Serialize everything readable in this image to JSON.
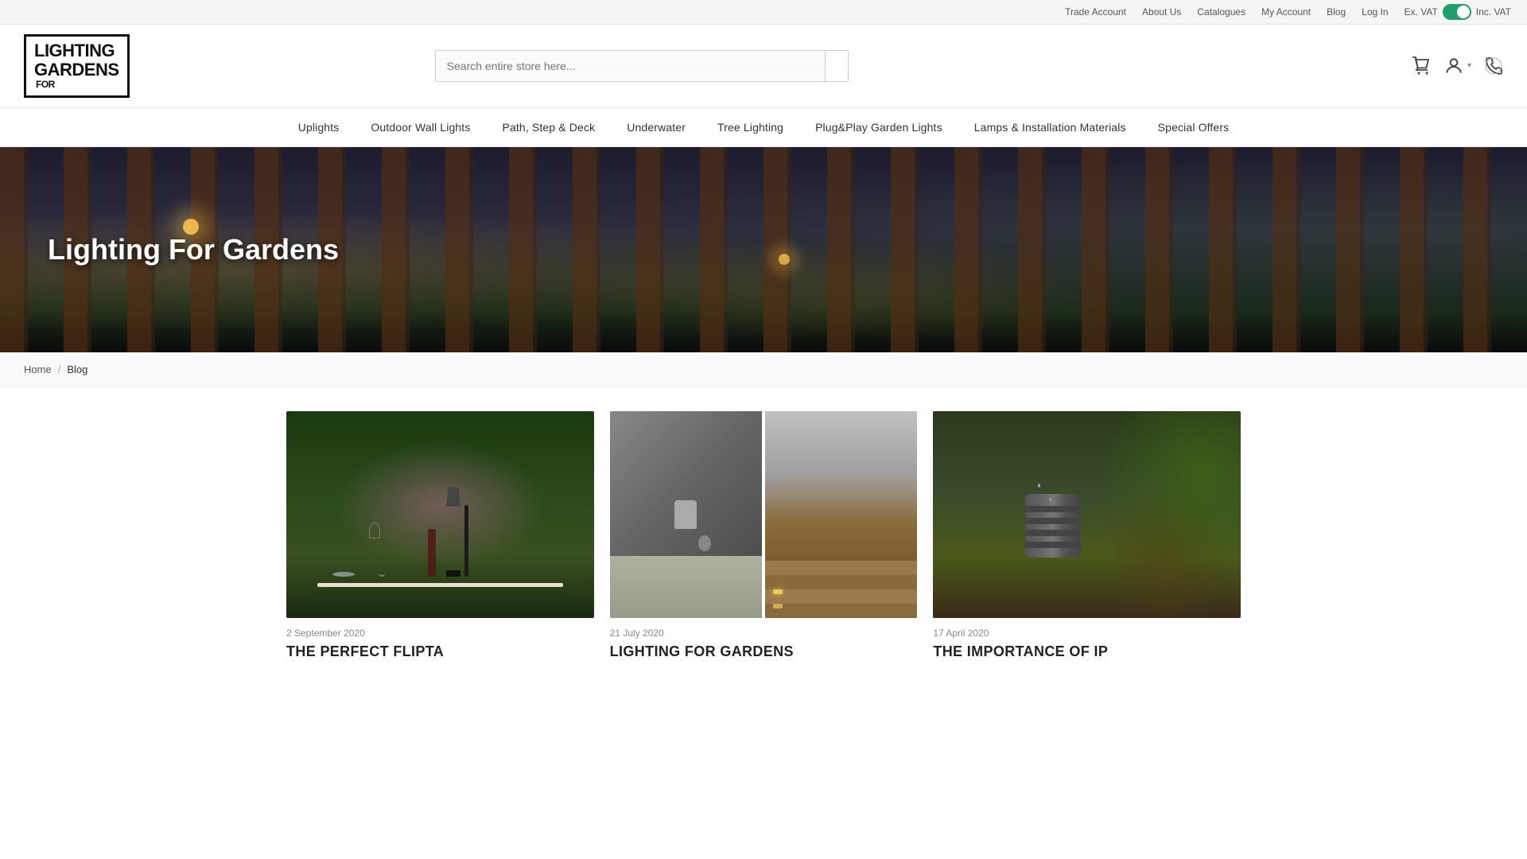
{
  "topbar": {
    "links": [
      {
        "label": "Trade Account",
        "name": "trade-account-link"
      },
      {
        "label": "About Us",
        "name": "about-us-link"
      },
      {
        "label": "Catalogues",
        "name": "catalogues-link"
      },
      {
        "label": "My Account",
        "name": "my-account-link"
      },
      {
        "label": "Blog",
        "name": "blog-link"
      },
      {
        "label": "Log In",
        "name": "login-link"
      }
    ],
    "vat_ex_label": "Ex. VAT",
    "vat_inc_label": "Inc. VAT"
  },
  "header": {
    "logo_line1": "LIGHTING",
    "logo_line2": "GARDENS",
    "logo_suffix": "FOR",
    "search_placeholder": "Search entire store here...",
    "cart_label": "Cart",
    "account_label": "Account",
    "phone_label": "Phone"
  },
  "nav": {
    "items": [
      {
        "label": "Uplights",
        "name": "nav-uplights"
      },
      {
        "label": "Outdoor Wall Lights",
        "name": "nav-outdoor-wall"
      },
      {
        "label": "Path, Step & Deck",
        "name": "nav-path-step-deck"
      },
      {
        "label": "Underwater",
        "name": "nav-underwater"
      },
      {
        "label": "Tree Lighting",
        "name": "nav-tree-lighting"
      },
      {
        "label": "Plug&Play Garden Lights",
        "name": "nav-plug-play"
      },
      {
        "label": "Lamps & Installation Materials",
        "name": "nav-lamps"
      },
      {
        "label": "Special Offers",
        "name": "nav-special-offers"
      }
    ]
  },
  "hero": {
    "title": "Lighting For Gardens"
  },
  "breadcrumb": {
    "home_label": "Home",
    "separator": "/",
    "current": "Blog"
  },
  "blog": {
    "posts": [
      {
        "date": "2 September 2020",
        "title": "THE PERFECT FLIPTA",
        "name": "post-flipta"
      },
      {
        "date": "21 July 2020",
        "title": "LIGHTING FOR GARDENS",
        "name": "post-lighting-gardens"
      },
      {
        "date": "17 April 2020",
        "title": "THE IMPORTANCE OF IP",
        "name": "post-importance-ip"
      }
    ]
  }
}
